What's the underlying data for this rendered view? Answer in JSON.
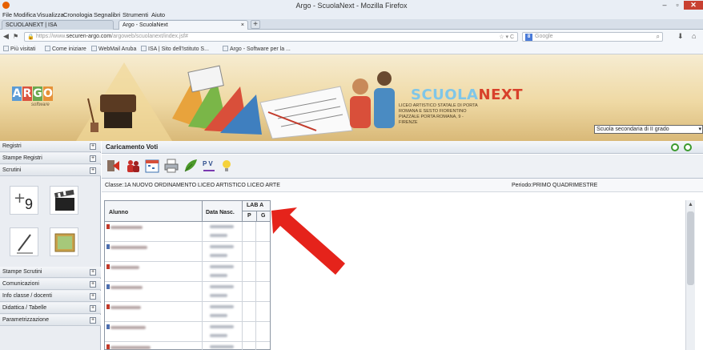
{
  "window": {
    "title": "Argo - ScuolaNext - Mozilla Firefox",
    "min": "–",
    "max": "▫",
    "close": "✕"
  },
  "menubar": [
    "File",
    "Modifica",
    "Visualizza",
    "Cronologia",
    "Segnalibri",
    "Strumenti",
    "Aiuto"
  ],
  "tabs": [
    {
      "label": "SCUOLANEXT | ISA",
      "active": false
    },
    {
      "label": "Argo - ScuolaNext",
      "active": true
    }
  ],
  "tab_close": "×",
  "tab_new": "+",
  "nav": {
    "back": "◀",
    "url_prefix": "https://www.",
    "url_domain": "securen-argo.com",
    "url_rest": "/argoweb/scuolanext/index.jsf#",
    "url_icons": "☆ ▾ C",
    "search_engine": "8",
    "search_placeholder": "Google",
    "search_icon": "🔍",
    "download": "⬇",
    "home": "⌂"
  },
  "bookmarks": [
    "Più visitati",
    "Come iniziare",
    "WebMail Aruba",
    "ISA | Sito dell'Istituto S...",
    "Argo - Software per la ..."
  ],
  "banner": {
    "argo_letters": [
      "A",
      "R",
      "G",
      "O"
    ],
    "argo_colors": [
      "#5b9bd5",
      "#d9533f",
      "#6aa84f",
      "#e69138"
    ],
    "argo_sub": "software",
    "sn_part1": "SCUOLA",
    "sn_part2": "NEXT",
    "school_lines": [
      "LICEO ARTISTICO STATALE DI PORTA",
      "ROMANA E SESTO FIORENTINO",
      "PIAZZALE PORTA ROMANA, 9 -",
      "FIRENZE"
    ],
    "school_select": "Scuola secondaria di II grado",
    "select_arrow": "▾"
  },
  "sidebar": {
    "top_items": [
      "Registri",
      "Stampe Registri",
      "Scrutini"
    ],
    "bottom_items": [
      "Stampe Scrutini",
      "Comunicazioni",
      "Info classe / docenti",
      "Didattica / Tabelle",
      "Parametrizzazione"
    ],
    "expander": "+",
    "tile_icons": [
      "plus-nine-icon",
      "clapperboard-icon",
      "pen-icon",
      "picture-icon"
    ],
    "tile_nine": "9"
  },
  "main": {
    "title": "Caricamento Voti",
    "class_label": "Classe:",
    "class_value": "1A NUOVO ORDINAMENTO LICEO ARTISTICO LICEO ARTE",
    "period": "Periodo:PRIMO QUADRIMESTRE",
    "toolbar_icons": [
      "exit-icon",
      "group-icon",
      "calendar-icon",
      "printer-icon",
      "leaf-pen-icon",
      "pv-icon",
      "lightbulb-icon"
    ],
    "tb_pv": "P V",
    "grid": {
      "col_student": "Alunno",
      "col_birth": "Data Nasc.",
      "col_subject": "LAB A",
      "sub_p": "P",
      "sub_g": "G"
    },
    "rows": 7,
    "scroll_up": "▲"
  },
  "colors": {
    "accent_green": "#3c9a2e",
    "arrow_red": "#e5231b"
  }
}
